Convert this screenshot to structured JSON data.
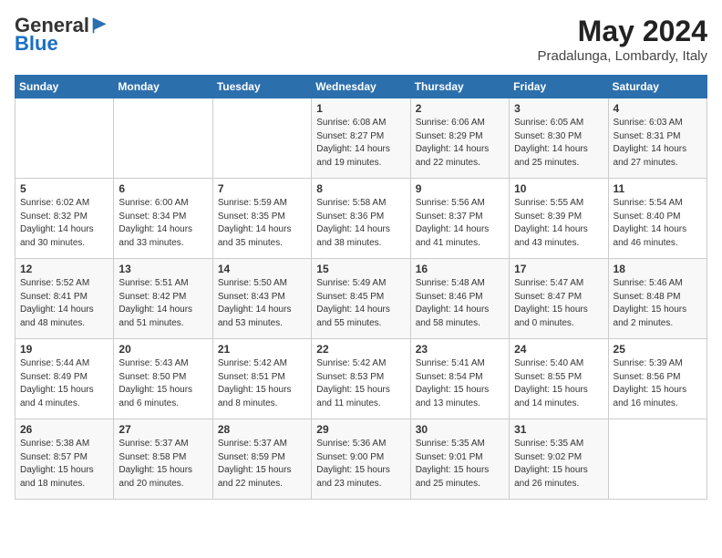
{
  "header": {
    "logo_general": "General",
    "logo_blue": "Blue",
    "month_title": "May 2024",
    "location": "Pradalunga, Lombardy, Italy"
  },
  "days_of_week": [
    "Sunday",
    "Monday",
    "Tuesday",
    "Wednesday",
    "Thursday",
    "Friday",
    "Saturday"
  ],
  "weeks": [
    [
      {
        "day": "",
        "info": ""
      },
      {
        "day": "",
        "info": ""
      },
      {
        "day": "",
        "info": ""
      },
      {
        "day": "1",
        "info": "Sunrise: 6:08 AM\nSunset: 8:27 PM\nDaylight: 14 hours\nand 19 minutes."
      },
      {
        "day": "2",
        "info": "Sunrise: 6:06 AM\nSunset: 8:29 PM\nDaylight: 14 hours\nand 22 minutes."
      },
      {
        "day": "3",
        "info": "Sunrise: 6:05 AM\nSunset: 8:30 PM\nDaylight: 14 hours\nand 25 minutes."
      },
      {
        "day": "4",
        "info": "Sunrise: 6:03 AM\nSunset: 8:31 PM\nDaylight: 14 hours\nand 27 minutes."
      }
    ],
    [
      {
        "day": "5",
        "info": "Sunrise: 6:02 AM\nSunset: 8:32 PM\nDaylight: 14 hours\nand 30 minutes."
      },
      {
        "day": "6",
        "info": "Sunrise: 6:00 AM\nSunset: 8:34 PM\nDaylight: 14 hours\nand 33 minutes."
      },
      {
        "day": "7",
        "info": "Sunrise: 5:59 AM\nSunset: 8:35 PM\nDaylight: 14 hours\nand 35 minutes."
      },
      {
        "day": "8",
        "info": "Sunrise: 5:58 AM\nSunset: 8:36 PM\nDaylight: 14 hours\nand 38 minutes."
      },
      {
        "day": "9",
        "info": "Sunrise: 5:56 AM\nSunset: 8:37 PM\nDaylight: 14 hours\nand 41 minutes."
      },
      {
        "day": "10",
        "info": "Sunrise: 5:55 AM\nSunset: 8:39 PM\nDaylight: 14 hours\nand 43 minutes."
      },
      {
        "day": "11",
        "info": "Sunrise: 5:54 AM\nSunset: 8:40 PM\nDaylight: 14 hours\nand 46 minutes."
      }
    ],
    [
      {
        "day": "12",
        "info": "Sunrise: 5:52 AM\nSunset: 8:41 PM\nDaylight: 14 hours\nand 48 minutes."
      },
      {
        "day": "13",
        "info": "Sunrise: 5:51 AM\nSunset: 8:42 PM\nDaylight: 14 hours\nand 51 minutes."
      },
      {
        "day": "14",
        "info": "Sunrise: 5:50 AM\nSunset: 8:43 PM\nDaylight: 14 hours\nand 53 minutes."
      },
      {
        "day": "15",
        "info": "Sunrise: 5:49 AM\nSunset: 8:45 PM\nDaylight: 14 hours\nand 55 minutes."
      },
      {
        "day": "16",
        "info": "Sunrise: 5:48 AM\nSunset: 8:46 PM\nDaylight: 14 hours\nand 58 minutes."
      },
      {
        "day": "17",
        "info": "Sunrise: 5:47 AM\nSunset: 8:47 PM\nDaylight: 15 hours\nand 0 minutes."
      },
      {
        "day": "18",
        "info": "Sunrise: 5:46 AM\nSunset: 8:48 PM\nDaylight: 15 hours\nand 2 minutes."
      }
    ],
    [
      {
        "day": "19",
        "info": "Sunrise: 5:44 AM\nSunset: 8:49 PM\nDaylight: 15 hours\nand 4 minutes."
      },
      {
        "day": "20",
        "info": "Sunrise: 5:43 AM\nSunset: 8:50 PM\nDaylight: 15 hours\nand 6 minutes."
      },
      {
        "day": "21",
        "info": "Sunrise: 5:42 AM\nSunset: 8:51 PM\nDaylight: 15 hours\nand 8 minutes."
      },
      {
        "day": "22",
        "info": "Sunrise: 5:42 AM\nSunset: 8:53 PM\nDaylight: 15 hours\nand 11 minutes."
      },
      {
        "day": "23",
        "info": "Sunrise: 5:41 AM\nSunset: 8:54 PM\nDaylight: 15 hours\nand 13 minutes."
      },
      {
        "day": "24",
        "info": "Sunrise: 5:40 AM\nSunset: 8:55 PM\nDaylight: 15 hours\nand 14 minutes."
      },
      {
        "day": "25",
        "info": "Sunrise: 5:39 AM\nSunset: 8:56 PM\nDaylight: 15 hours\nand 16 minutes."
      }
    ],
    [
      {
        "day": "26",
        "info": "Sunrise: 5:38 AM\nSunset: 8:57 PM\nDaylight: 15 hours\nand 18 minutes."
      },
      {
        "day": "27",
        "info": "Sunrise: 5:37 AM\nSunset: 8:58 PM\nDaylight: 15 hours\nand 20 minutes."
      },
      {
        "day": "28",
        "info": "Sunrise: 5:37 AM\nSunset: 8:59 PM\nDaylight: 15 hours\nand 22 minutes."
      },
      {
        "day": "29",
        "info": "Sunrise: 5:36 AM\nSunset: 9:00 PM\nDaylight: 15 hours\nand 23 minutes."
      },
      {
        "day": "30",
        "info": "Sunrise: 5:35 AM\nSunset: 9:01 PM\nDaylight: 15 hours\nand 25 minutes."
      },
      {
        "day": "31",
        "info": "Sunrise: 5:35 AM\nSunset: 9:02 PM\nDaylight: 15 hours\nand 26 minutes."
      },
      {
        "day": "",
        "info": ""
      }
    ]
  ]
}
